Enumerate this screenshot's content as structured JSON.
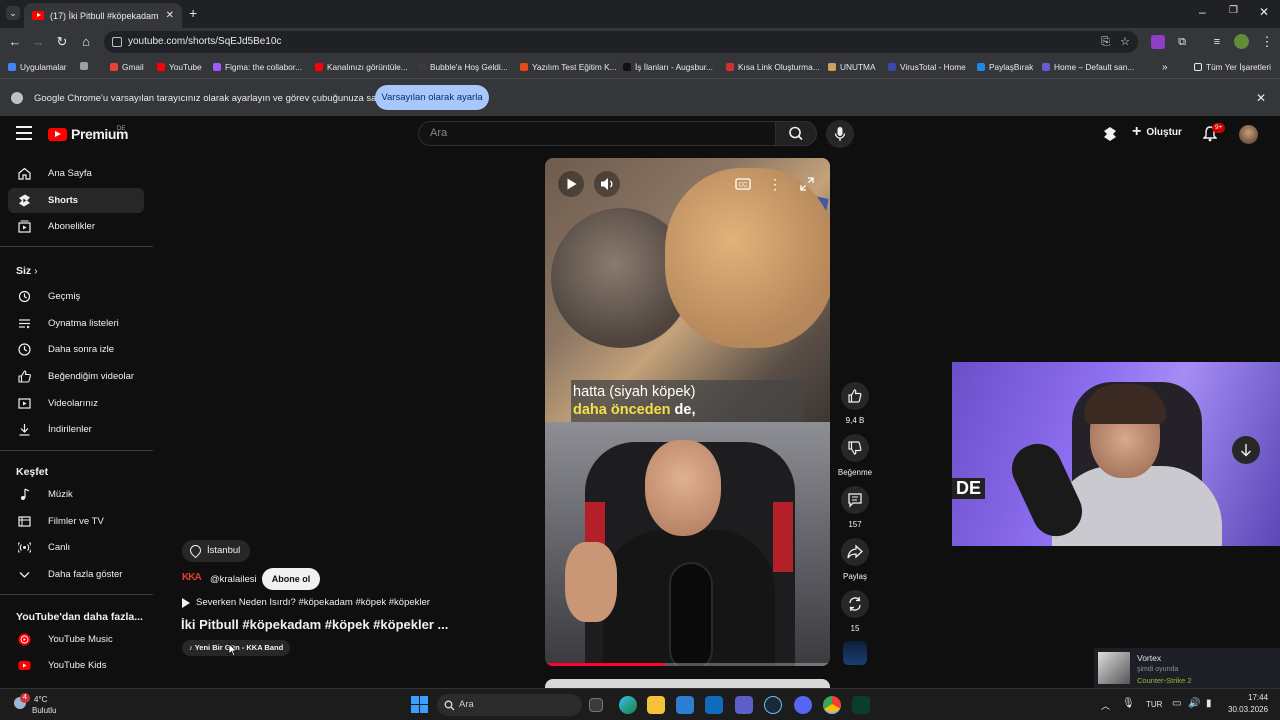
{
  "browser": {
    "tab_title": "(17) İki Pitbull #köpekadam #k",
    "url": "youtube.com/shorts/SqEJd5Be10c",
    "bookmarks": [
      {
        "label": "Uygulamalar",
        "color": "#4285f4"
      },
      {
        "label": "Gmail",
        "color": "#ea4335"
      },
      {
        "label": "YouTube",
        "color": "#ff0000"
      },
      {
        "label": "Figma: the collabor...",
        "color": "#a259ff"
      },
      {
        "label": "Kanalınızı görüntüle...",
        "color": "#ff0000"
      },
      {
        "label": "Bubble'a Hoş Geldi...",
        "color": "#1a1a1a"
      },
      {
        "label": "Yazılım Test Eğitim K...",
        "color": "#e64a19"
      },
      {
        "label": "İş İlanları - Augsbur...",
        "color": "#1a1a1a"
      },
      {
        "label": "Kısa Link Oluşturma...",
        "color": "#d32f2f"
      },
      {
        "label": "UNUTMA",
        "color": "#c8a25a"
      },
      {
        "label": "VirusTotal - Home",
        "color": "#3949ab"
      },
      {
        "label": "PaylaşBırak",
        "color": "#1e88e5"
      },
      {
        "label": "Home – Default san...",
        "color": "#6a5acd"
      }
    ],
    "all_bookmarks": "Tüm Yer İşaretleri",
    "infobar": {
      "message": "Google Chrome'u varsayılan tarayıcınız olarak ayarlayın ve görev çubuğunuza sabitleyin",
      "button": "Varsayılan olarak ayarla"
    }
  },
  "youtube": {
    "logo": "Premium",
    "logo_region": "DE",
    "search_placeholder": "Ara",
    "create_label": "Oluştur",
    "notification_count": "9+",
    "sidebar": {
      "main": [
        {
          "label": "Ana Sayfa",
          "icon": "home-icon"
        },
        {
          "label": "Shorts",
          "icon": "shorts-icon"
        },
        {
          "label": "Abonelikler",
          "icon": "subscriptions-icon"
        }
      ],
      "you_header": "Siz",
      "you": [
        {
          "label": "Geçmiş",
          "icon": "history-icon"
        },
        {
          "label": "Oynatma listeleri",
          "icon": "playlists-icon"
        },
        {
          "label": "Daha sonra izle",
          "icon": "clock-icon"
        },
        {
          "label": "Beğendiğim videolar",
          "icon": "like-icon"
        },
        {
          "label": "Videolarınız",
          "icon": "video-icon"
        },
        {
          "label": "İndirilenler",
          "icon": "download-icon"
        }
      ],
      "explore_header": "Keşfet",
      "explore": [
        {
          "label": "Müzik",
          "icon": "music-icon"
        },
        {
          "label": "Filmler ve TV",
          "icon": "film-icon"
        },
        {
          "label": "Canlı",
          "icon": "live-icon"
        },
        {
          "label": "Daha fazla göster",
          "icon": "chevron-down-icon"
        }
      ],
      "more_header": "YouTube'dan daha fazla...",
      "more": [
        {
          "label": "YouTube Music",
          "icon": "youtube-music-icon"
        },
        {
          "label": "YouTube Kids",
          "icon": "youtube-kids-icon"
        }
      ]
    },
    "short": {
      "caption_line1": "hatta (siyah köpek)",
      "caption_line2_highlight": "daha önceden",
      "caption_line2_rest": " de,",
      "progress": 0.42,
      "location": "İstanbul",
      "channel_logo": "KKA",
      "channel": "@kralailesi",
      "subscribe": "Abone ol",
      "related": "Severken Neden Isırdı? #köpekadam #köpek #köpekler",
      "title": "İki Pitbull #köpekadam #köpek #köpekler ...",
      "sound": "Yeni Bir Gün - KKA Band"
    },
    "actions": {
      "likes": "9,4 B",
      "dislike": "Beğenme",
      "comments": "157",
      "share": "Paylaş",
      "remix": "15"
    },
    "webcam_text": "DE"
  },
  "steam_toast": {
    "name": "Vortex",
    "status": "şimdi oyunda",
    "game": "Counter-Strike 2"
  },
  "taskbar": {
    "weather_temp": "4°C",
    "weather_desc": "Bulutlu",
    "weather_badge": "4",
    "search": "Ara",
    "lang": "TUR",
    "time": "17:44",
    "date": "30.03.2026"
  }
}
